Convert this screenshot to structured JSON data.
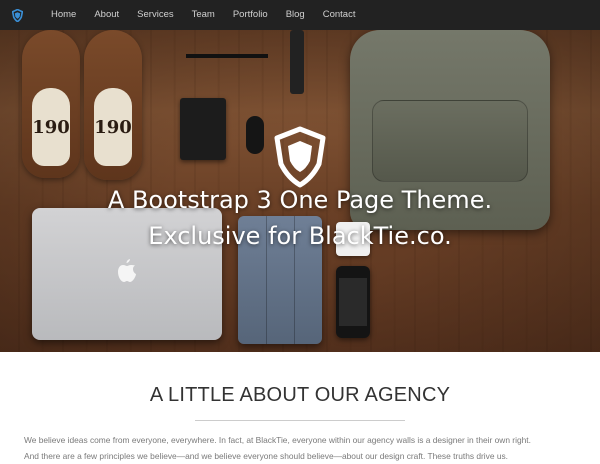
{
  "nav": {
    "brand_icon": "shield-icon",
    "items": [
      {
        "label": "Home"
      },
      {
        "label": "About"
      },
      {
        "label": "Services"
      },
      {
        "label": "Team"
      },
      {
        "label": "Portfolio"
      },
      {
        "label": "Blog"
      },
      {
        "label": "Contact"
      }
    ]
  },
  "hero": {
    "logo_icon": "shield-icon",
    "title_line1": "A Bootstrap 3 One Page Theme.",
    "title_line2": "Exclusive for BlackTie.co.",
    "shoe_text": "190"
  },
  "about": {
    "heading": "A LITTLE ABOUT OUR AGENCY",
    "paragraph_line1": "We believe ideas come from everyone, everywhere. In fact, at BlackTie, everyone within our agency walls is a designer in their own right.",
    "paragraph_line2": "And there are a few principles we believe—and we believe everyone should believe—about our design craft. These truths drive us."
  },
  "colors": {
    "navbar": "#222222",
    "brand_accent": "#3a8fd6",
    "nav_text": "#d0d0d0",
    "heading_text": "#333333",
    "body_text": "#7a7a7a"
  }
}
